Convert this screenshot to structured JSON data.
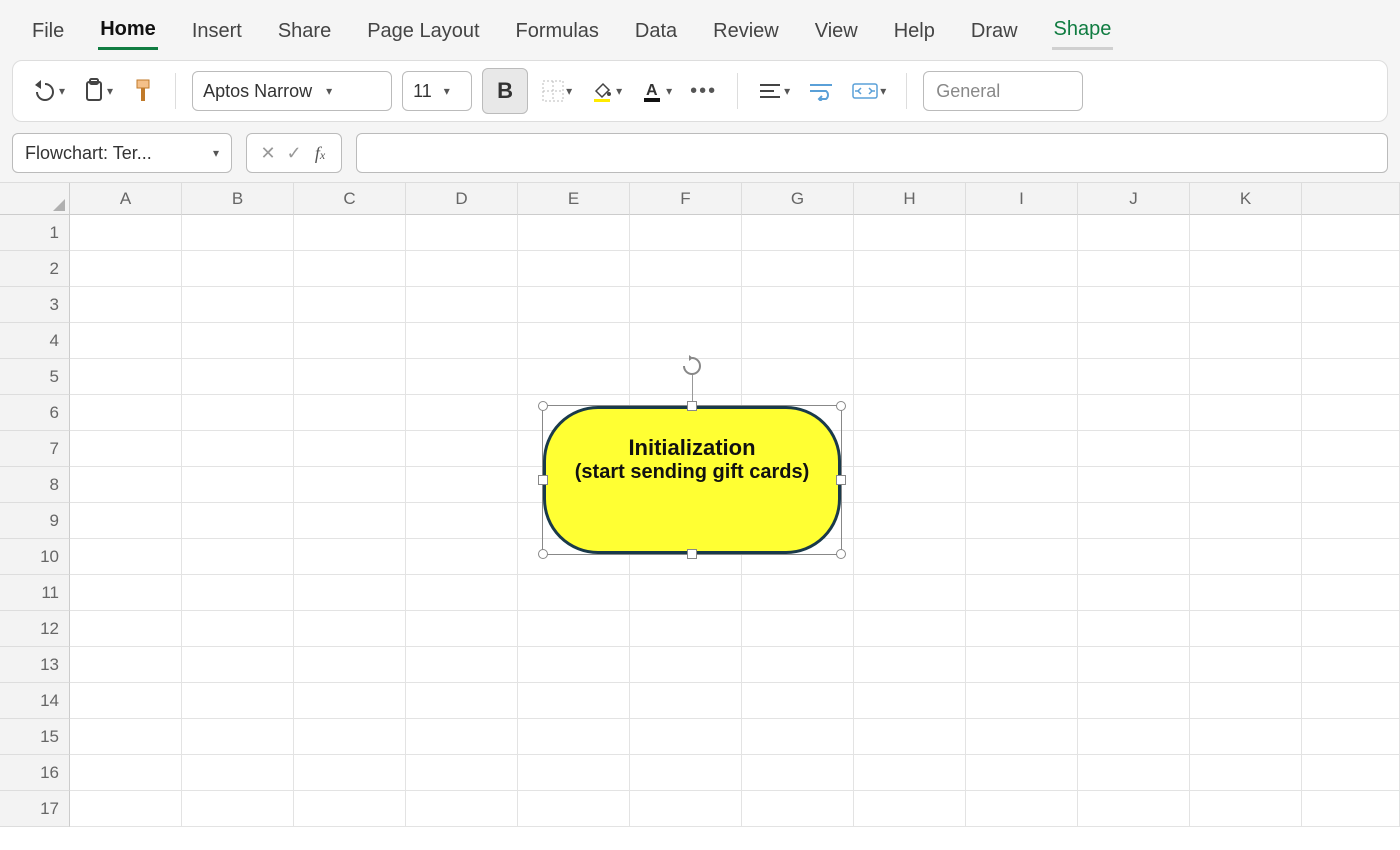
{
  "tabs": {
    "file": "File",
    "home": "Home",
    "insert": "Insert",
    "share": "Share",
    "pagelayout": "Page Layout",
    "formulas": "Formulas",
    "data": "Data",
    "review": "Review",
    "view": "View",
    "help": "Help",
    "draw": "Draw",
    "shape": "Shape"
  },
  "toolbar": {
    "font_name": "Aptos Narrow",
    "font_size": "11",
    "bold": "B",
    "number_format": "General"
  },
  "namebox": "Flowchart: Ter...",
  "formula": "",
  "columns": [
    "A",
    "B",
    "C",
    "D",
    "E",
    "F",
    "G",
    "H",
    "I",
    "J",
    "K"
  ],
  "rows": [
    "1",
    "2",
    "3",
    "4",
    "5",
    "6",
    "7",
    "8",
    "9",
    "10",
    "11",
    "12",
    "13",
    "14",
    "15",
    "16",
    "17"
  ],
  "shape": {
    "title": "Initialization",
    "subtitle": "(start sending gift cards)",
    "fill": "#ffff33",
    "border": "#1a3a4a"
  }
}
